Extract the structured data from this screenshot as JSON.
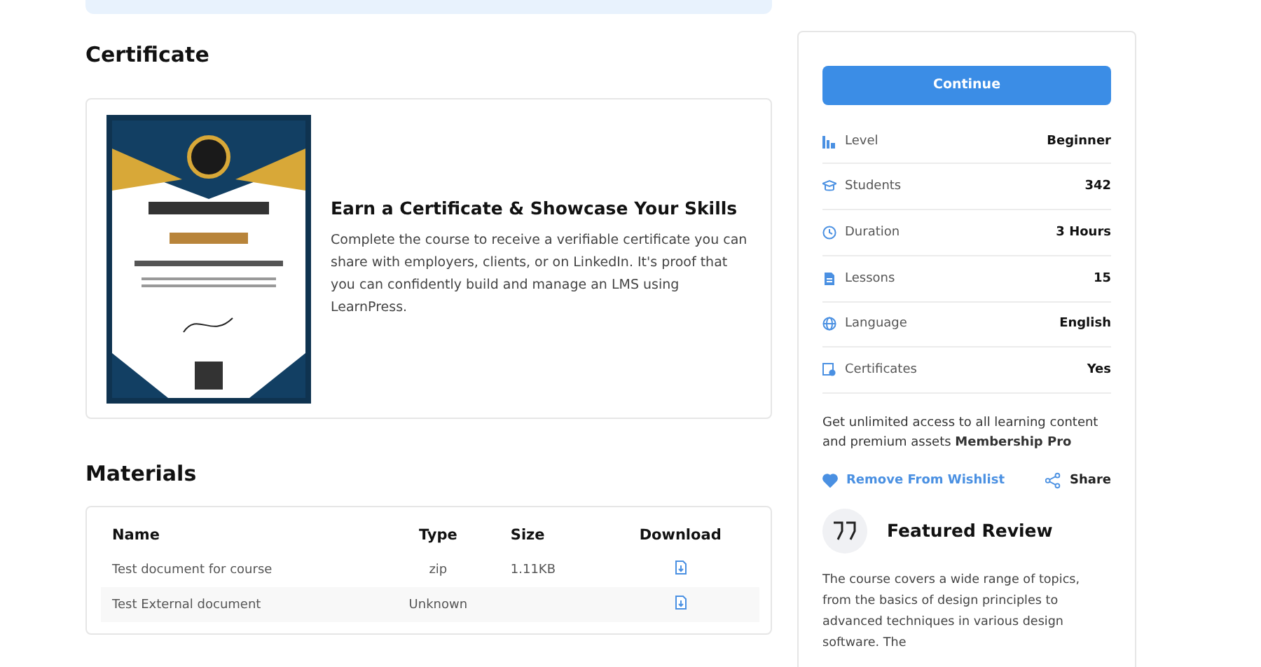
{
  "certificate": {
    "title": "Certificate",
    "heading": "Earn a Certificate & Showcase Your Skills",
    "description": "Complete the course to receive a verifiable certificate you can share with employers, clients, or on LinkedIn. It's proof that you can confidently build and manage an LMS using LearnPress."
  },
  "materials": {
    "title": "Materials",
    "columns": [
      "Name",
      "Type",
      "Size",
      "Download"
    ],
    "rows": [
      {
        "name": "Test document for course",
        "type": "zip",
        "size": "1.11KB"
      },
      {
        "name": "Test External document",
        "type": "Unknown"
      }
    ]
  },
  "sidebar": {
    "button": "Continue",
    "info": [
      {
        "kind": "level",
        "label": "Level",
        "value": "Beginner"
      },
      {
        "kind": "students",
        "label": "Students",
        "value": "342"
      },
      {
        "kind": "duration",
        "label": "Duration",
        "value": "3 Hours"
      },
      {
        "kind": "lessons",
        "label": "Lessons",
        "value": "15"
      },
      {
        "kind": "language",
        "label": "Language",
        "value": "English"
      },
      {
        "kind": "certificates",
        "label": "Certificates",
        "value": "Yes"
      }
    ],
    "membership": "Get unlimited access to all learning content and premium assets **Membership Pro**",
    "wishlist": {
      "label": "Remove From Wishlist",
      "selected": true
    },
    "share": "Share",
    "review": {
      "title": "Featured Review",
      "text": "The course covers a wide range of topics, from the basics of design principles to advanced techniques in various design software. The"
    }
  }
}
